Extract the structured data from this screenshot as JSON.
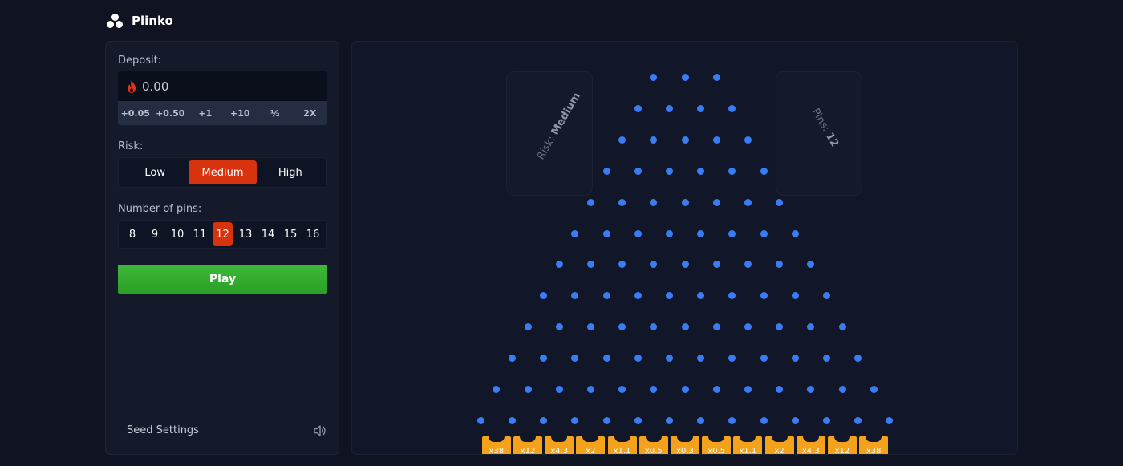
{
  "header": {
    "title": "Plinko",
    "logo_icon": "plinko-logo-icon"
  },
  "sidebar": {
    "deposit_label": "Deposit:",
    "deposit_value": "0.00",
    "deposit_icon": "flame-icon",
    "quick_amounts": [
      "+0.05",
      "+0.50",
      "+1",
      "+10",
      "½",
      "2X"
    ],
    "risk_label": "Risk:",
    "risk_options": [
      "Low",
      "Medium",
      "High"
    ],
    "risk_selected": "Medium",
    "pins_label": "Number of pins:",
    "pin_options": [
      "8",
      "9",
      "10",
      "11",
      "12",
      "13",
      "14",
      "15",
      "16"
    ],
    "pins_selected": "12",
    "play_label": "Play",
    "seed_settings_label": "Seed Settings",
    "sound_icon": "speaker-icon"
  },
  "board": {
    "risk_tag_prefix": "Risk:",
    "risk_tag_value": "Medium",
    "pins_tag_prefix": "Pins:",
    "pins_tag_value": "12",
    "rows": 12,
    "multipliers": [
      "x38",
      "x12",
      "x4.3",
      "x2",
      "x1.1",
      "x0.5",
      "x0.3",
      "x0.5",
      "x1.1",
      "x2",
      "x4.3",
      "x12",
      "x38"
    ]
  },
  "colors": {
    "accent": "#d8330f",
    "play": "#35ae30",
    "peg": "#3a7cf4",
    "bucket": "#f4a21b",
    "background": "#0f1322"
  }
}
